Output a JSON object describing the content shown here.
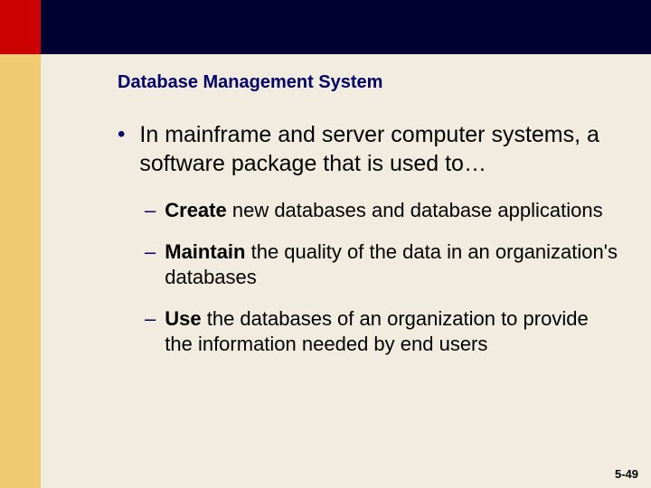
{
  "title": "Database Management System",
  "main_bullet": "In mainframe and server computer systems, a software package that is used to…",
  "sub_bullets": [
    {
      "bold": "Create",
      "rest": " new databases and database applications"
    },
    {
      "bold": "Maintain",
      "rest": " the quality of the data in an organization's databases"
    },
    {
      "bold": "Use",
      "rest": " the databases of an organization to provide the information needed by end users"
    }
  ],
  "page_number": "5-49"
}
